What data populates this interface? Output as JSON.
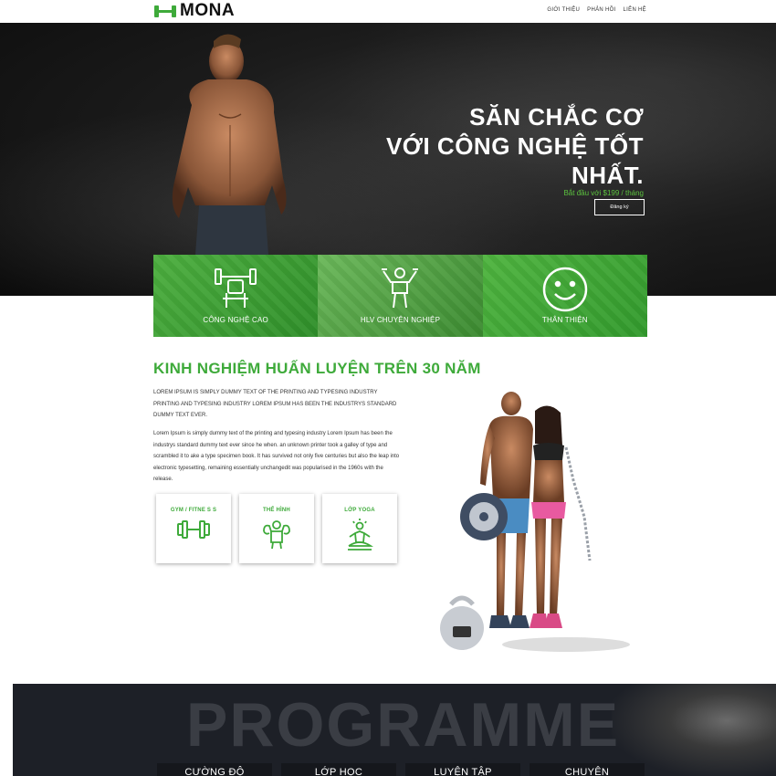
{
  "brand": {
    "name": "MONA",
    "accent": "#3eaa3a"
  },
  "nav": {
    "items": [
      "GIỚI THIỆU",
      "PHẢN HỒI",
      "LIÊN HỆ"
    ]
  },
  "hero": {
    "title_line1": "SĂN CHẮC CƠ",
    "title_line2": "VỚI CÔNG NGHỆ TỐT",
    "title_line3": "NHẤT.",
    "subtitle": "Bắt đầu với $199 / tháng",
    "cta_label": "Đăng ký"
  },
  "features": [
    {
      "label": "CÔNG NGHỆ CAO",
      "icon": "bench-press-icon"
    },
    {
      "label": "HLV CHUYÊN NGHIỆP",
      "icon": "trainer-icon"
    },
    {
      "label": "THÂN THIỆN",
      "icon": "smiley-icon"
    }
  ],
  "about": {
    "title": "KINH NGHIỆM HUẤN LUYỆN TRÊN 30 NĂM",
    "caps_text": "LOREM IPSUM IS SIMPLY DUMMY TEXT OF THE PRINTING AND TYPESING INDUSTRY PRINTING AND TYPESING INDUSTRY LOREM IPSUM HAS BEEN THE INDUSTRYS STANDARD DUMMY TEXT EVER.",
    "body_text": "Lorem Ipsum is simply dummy text of the printing and typesing industry Lorem Ipsum has been the industrys standard dummy text ever since he when. an unknown printer took a galley of type and scrambled it to ake a type specimen book. It has survived not only five centuries but also the leap into electronic typesetting, remaining essentially unchangedit was popularised in the 1960s with the release."
  },
  "cards": [
    {
      "label": "GYM / FITNE S S",
      "icon": "dumbbell-icon"
    },
    {
      "label": "THỂ HÌNH",
      "icon": "bodybuilder-icon"
    },
    {
      "label": "LỚP YOGA",
      "icon": "yoga-icon"
    }
  ],
  "programme": {
    "title": "PROGRAMME",
    "tabs": [
      "CƯỜNG ĐỘ",
      "LỚP HỌC",
      "LUYỆN TẬP",
      "CHUYÊN"
    ]
  }
}
